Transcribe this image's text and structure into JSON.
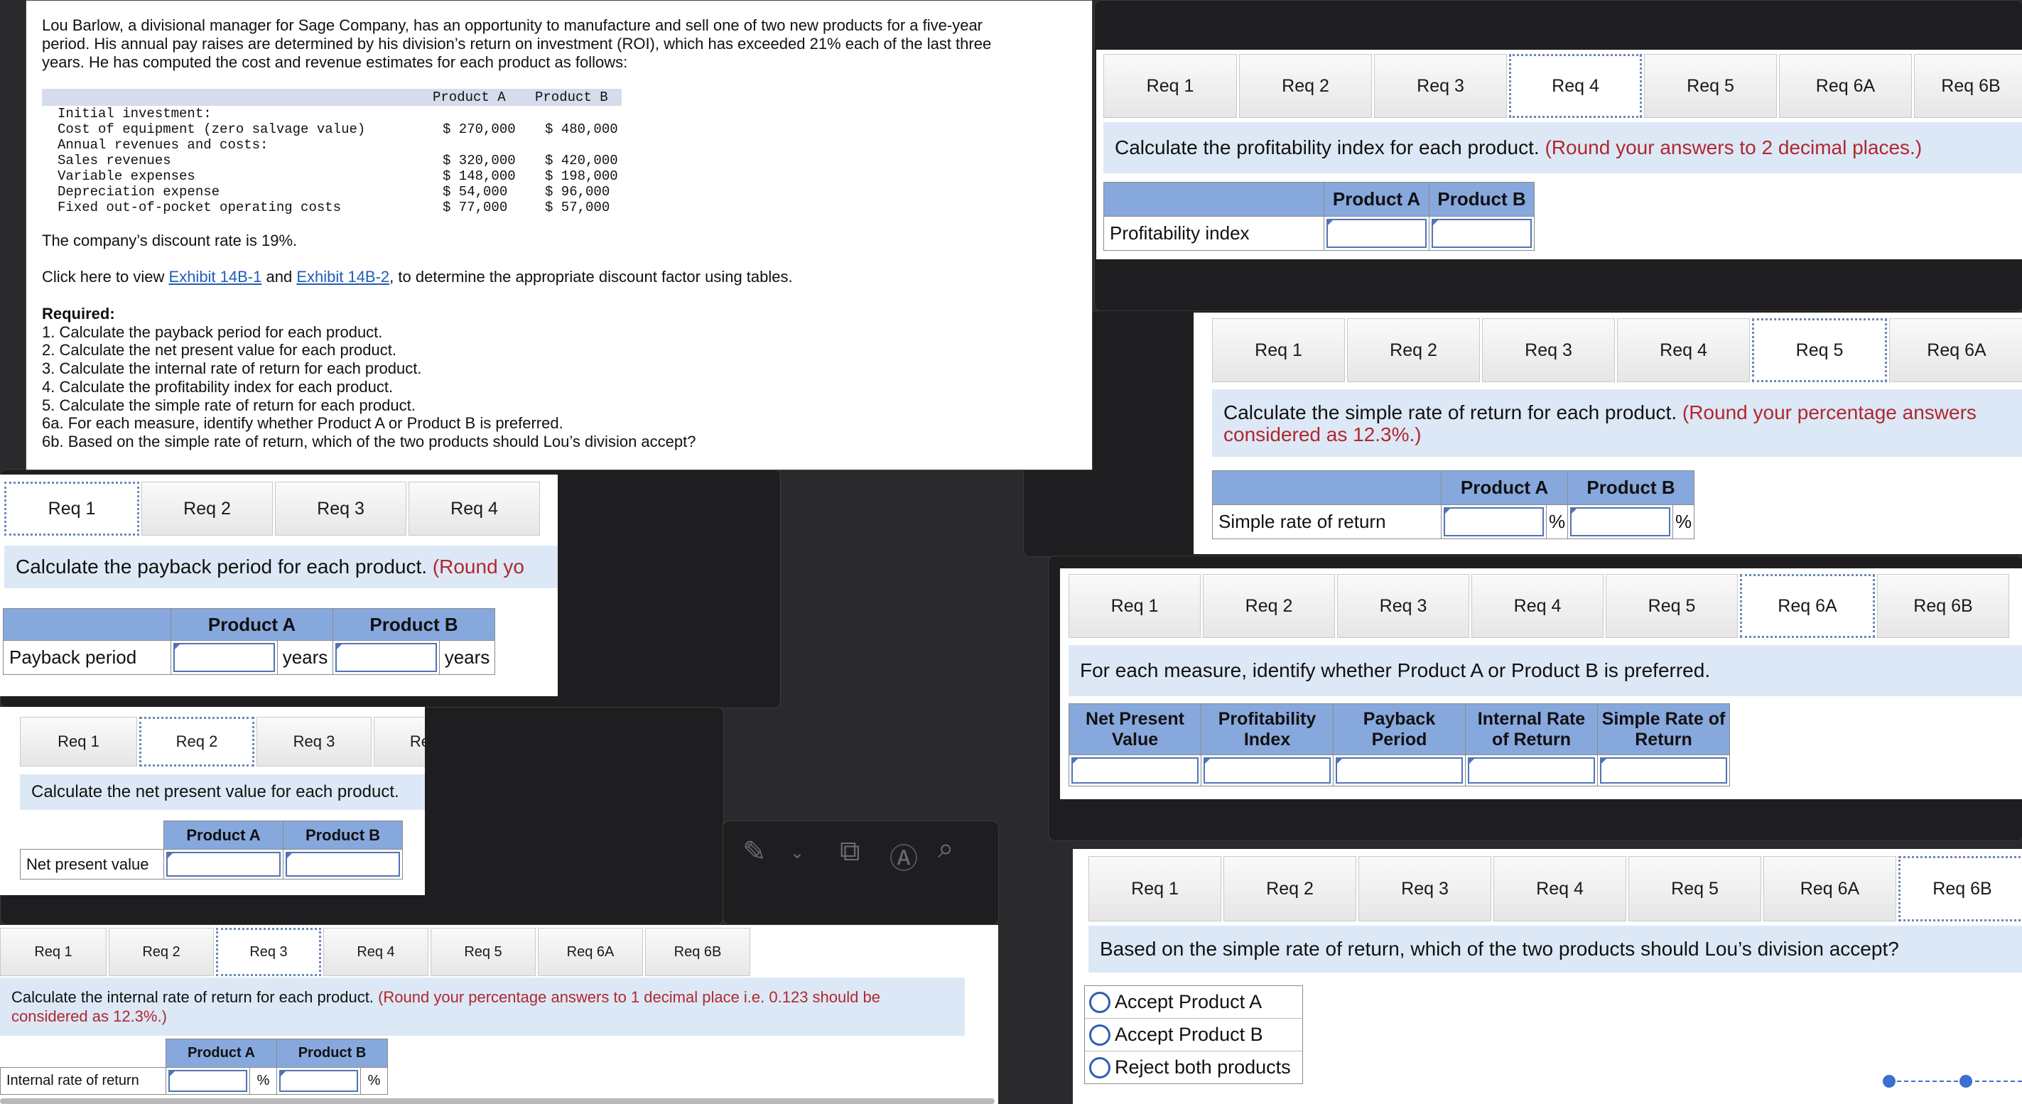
{
  "problem": {
    "intro": "Lou Barlow, a divisional manager for Sage Company, has an opportunity to manufacture and sell one of two new products for a five-year period. His annual pay raises are determined by his division’s return on investment (ROI), which has exceeded 21% each of the last three years. He has computed the cost and revenue estimates for each product as follows:",
    "table": {
      "col_a": "Product A",
      "col_b": "Product B",
      "rows": [
        {
          "label": "Initial investment:",
          "a": "",
          "b": ""
        },
        {
          "label": "Cost of equipment (zero salvage value)",
          "a": "$ 270,000",
          "b": "$ 480,000"
        },
        {
          "label": "Annual revenues and costs:",
          "a": "",
          "b": ""
        },
        {
          "label": "Sales revenues",
          "a": "$ 320,000",
          "b": "$ 420,000"
        },
        {
          "label": "Variable expenses",
          "a": "$ 148,000",
          "b": "$ 198,000"
        },
        {
          "label": "Depreciation expense",
          "a": "$ 54,000",
          "b": "$ 96,000"
        },
        {
          "label": "Fixed out-of-pocket operating costs",
          "a": "$ 77,000",
          "b": "$ 57,000"
        }
      ]
    },
    "discount": "The company’s discount rate is 19%.",
    "click_prefix": "Click here to view ",
    "link1": "Exhibit 14B-1",
    "and": " and ",
    "link2": "Exhibit 14B-2",
    "click_suffix": ", to determine the appropriate discount factor using tables.",
    "required_title": "Required:",
    "required": [
      "1. Calculate the payback period for each product.",
      "2. Calculate the net present value for each product.",
      "3. Calculate the internal rate of return for each product.",
      "4. Calculate the profitability index for each product.",
      "5. Calculate the simple rate of return for each product.",
      "6a. For each measure, identify whether Product A or Product B is preferred.",
      "6b. Based on the simple rate of return, which of the two products should Lou’s division accept?"
    ]
  },
  "tabs": {
    "req1": "Req 1",
    "req2": "Req 2",
    "req3": "Req 3",
    "req4": "Req 4",
    "req5": "Req 5",
    "req6a": "Req 6A",
    "req6b": "Req 6B",
    "re_partial": "Re"
  },
  "common": {
    "product_a": "Product A",
    "product_b": "Product B",
    "years": "years",
    "percent": "%"
  },
  "req1": {
    "question": "Calculate the payback period for each product.",
    "note_partial": "(Round yo",
    "row_label": "Payback period"
  },
  "req2": {
    "question": "Calculate the net present value for each product.",
    "row_label": "Net present value"
  },
  "req3": {
    "question": "Calculate the internal rate of return for each product.",
    "note": "(Round your percentage answers to 1 decimal place i.e. 0.123 should be",
    "note2": "considered as 12.3%.)",
    "row_label": "Internal rate of return"
  },
  "req4": {
    "question": "Calculate the profitability index for each product.",
    "note": "(Round your answers to 2 decimal places.)",
    "row_label": "Profitability index"
  },
  "req5": {
    "question": "Calculate the simple rate of return for each product.",
    "note": "(Round your percentage answers",
    "note2": "considered as 12.3%.)",
    "row_label": "Simple rate of return"
  },
  "req6a": {
    "question": "For each measure, identify whether Product A or Product B is preferred.",
    "headers": [
      {
        "l1": "Net Present",
        "l2": "Value"
      },
      {
        "l1": "Profitability",
        "l2": "Index"
      },
      {
        "l1": "Payback",
        "l2": "Period"
      },
      {
        "l1": "Internal Rate",
        "l2": "of Return"
      },
      {
        "l1": "Simple Rate of",
        "l2": "Return"
      }
    ]
  },
  "req6b": {
    "question": "Based on the simple rate of return, which of the two products should Lou’s division accept?",
    "options": [
      "Accept Product A",
      "Accept Product B",
      "Reject both products"
    ]
  }
}
